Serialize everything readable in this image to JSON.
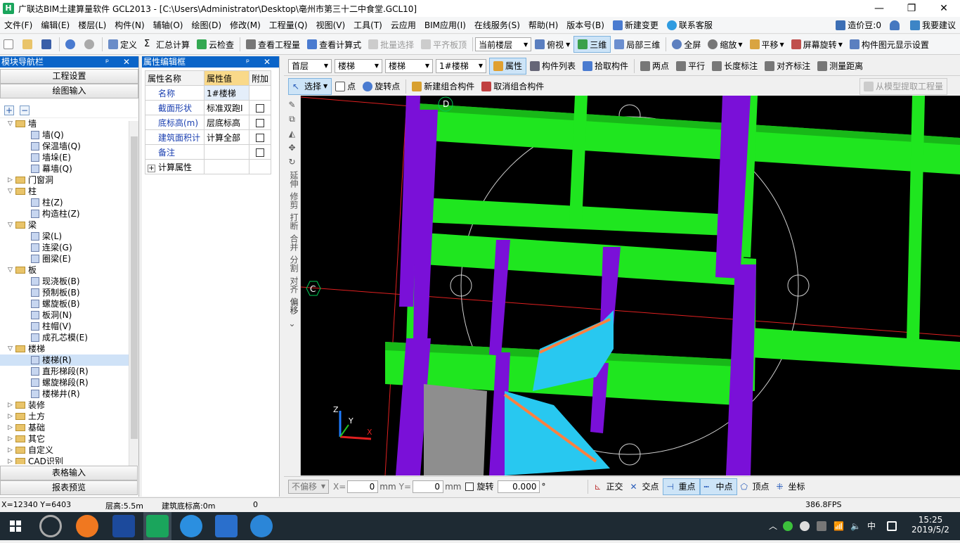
{
  "window": {
    "app_icon": "H",
    "title": "广联达BIM土建算量软件 GCL2013 - [C:\\Users\\Administrator\\Desktop\\亳州市第三十二中食堂.GCL10]",
    "minimize": "—",
    "maximize": "❐",
    "close": "✕"
  },
  "menu": {
    "items": [
      "文件(F)",
      "编辑(E)",
      "楼层(L)",
      "构件(N)",
      "辅轴(O)",
      "绘图(D)",
      "修改(M)",
      "工程量(Q)",
      "视图(V)",
      "工具(T)",
      "云应用",
      "BIM应用(I)",
      "在线服务(S)",
      "帮助(H)",
      "版本号(B)",
      "新建变更",
      "联系客服"
    ],
    "right": {
      "coin": "造价豆:0",
      "feedback": "我要建议"
    }
  },
  "toolbar": {
    "define": "定义",
    "summary": "汇总计算",
    "cloud_check": "云检查",
    "view_qty": "查看工程量",
    "view_formula": "查看计算式",
    "batch_select": "批量选择",
    "flat_top": "平齐板顶",
    "floor_combo": "当前楼层",
    "view_mode": "俯视",
    "three_d": "三维",
    "local_3d": "局部三维",
    "fullscreen": "全屏",
    "zoom": "缩放",
    "pan": "平移",
    "rotate": "屏幕旋转",
    "display_settings": "构件图元显示设置"
  },
  "nav": {
    "title": "模块导航栏",
    "pin": "ᵖ ✕",
    "project_settings": "工程设置",
    "drawing_input": "绘图输入",
    "table_input": "表格输入",
    "report_preview": "报表预览",
    "tree": [
      {
        "label": "墙",
        "level": 0,
        "exp": "▽"
      },
      {
        "label": "墙(Q)",
        "level": 1
      },
      {
        "label": "保温墙(Q)",
        "level": 1
      },
      {
        "label": "墙垛(E)",
        "level": 1
      },
      {
        "label": "幕墙(Q)",
        "level": 1
      },
      {
        "label": "门窗洞",
        "level": 0,
        "exp": "▷"
      },
      {
        "label": "柱",
        "level": 0,
        "exp": "▽"
      },
      {
        "label": "柱(Z)",
        "level": 1
      },
      {
        "label": "构造柱(Z)",
        "level": 1
      },
      {
        "label": "梁",
        "level": 0,
        "exp": "▽"
      },
      {
        "label": "梁(L)",
        "level": 1
      },
      {
        "label": "连梁(G)",
        "level": 1
      },
      {
        "label": "圈梁(E)",
        "level": 1
      },
      {
        "label": "板",
        "level": 0,
        "exp": "▽"
      },
      {
        "label": "现浇板(B)",
        "level": 1
      },
      {
        "label": "预制板(B)",
        "level": 1
      },
      {
        "label": "螺旋板(B)",
        "level": 1
      },
      {
        "label": "板洞(N)",
        "level": 1
      },
      {
        "label": "柱帽(V)",
        "level": 1
      },
      {
        "label": "成孔芯模(E)",
        "level": 1
      },
      {
        "label": "楼梯",
        "level": 0,
        "exp": "▽"
      },
      {
        "label": "楼梯(R)",
        "level": 1,
        "selected": true
      },
      {
        "label": "直形梯段(R)",
        "level": 1
      },
      {
        "label": "螺旋梯段(R)",
        "level": 1
      },
      {
        "label": "楼梯井(R)",
        "level": 1
      },
      {
        "label": "装修",
        "level": 0,
        "exp": "▷"
      },
      {
        "label": "土方",
        "level": 0,
        "exp": "▷"
      },
      {
        "label": "基础",
        "level": 0,
        "exp": "▷"
      },
      {
        "label": "其它",
        "level": 0,
        "exp": "▷"
      },
      {
        "label": "自定义",
        "level": 0,
        "exp": "▷"
      },
      {
        "label": "CAD识别",
        "level": 0,
        "exp": "▷"
      }
    ]
  },
  "props": {
    "title": "属性编辑框",
    "pin": "ᵖ ✕",
    "col_name": "属性名称",
    "col_value": "属性值",
    "col_extra": "附加",
    "rows": [
      {
        "name": "名称",
        "value": "1#楼梯",
        "check": false
      },
      {
        "name": "截面形状",
        "value": "标准双跑I",
        "check": true
      },
      {
        "name": "底标高(m)",
        "value": "层底标高",
        "check": true
      },
      {
        "name": "建筑面积计",
        "value": "计算全部",
        "check": true
      },
      {
        "name": "备注",
        "value": "",
        "check": true
      },
      {
        "name": "计算属性",
        "value": "",
        "check": false,
        "expand": "+"
      }
    ]
  },
  "subbar1": {
    "floor": "首层",
    "cat": "楼梯",
    "type": "楼梯",
    "item": "1#楼梯",
    "attr": "属性",
    "list": "构件列表",
    "pick": "拾取构件",
    "two_point": "两点",
    "parallel": "平行",
    "length_dim": "长度标注",
    "align_dim": "对齐标注",
    "measure": "测量距离"
  },
  "subbar2": {
    "select": "选择",
    "point": "点",
    "rotate_point": "旋转点",
    "new_group": "新建组合构件",
    "cancel_group": "取消组合构件",
    "extract": "从模型提取工程量"
  },
  "vtools": [
    "延伸",
    "修剪",
    "打断",
    "合并",
    "分割",
    "对齐",
    "偏移"
  ],
  "canvas": {
    "axis_d": "D",
    "axis_c": "C",
    "axis_z": "Z",
    "axis_y": "Y",
    "axis_x": "X"
  },
  "bottom": {
    "offset_mode": "不偏移",
    "x_label": "X=",
    "x_val": "0",
    "y_label": "Y=",
    "y_val": "0",
    "unit": "mm",
    "rotate_label": "旋转",
    "rotate_val": "0.000",
    "deg": "°",
    "ortho": "正交",
    "intersect": "交点",
    "endpoint": "重点",
    "midpoint": "中点",
    "vertex": "顶点",
    "coord": "坐标"
  },
  "status": {
    "coords": "X=12340 Y=6403",
    "floor_h": "层高:5.5m",
    "base_elev": "建筑底标高:0m",
    "zero": "0",
    "fps": "386.8FPS"
  },
  "taskbar": {
    "time": "15:25",
    "date": "2019/5/2",
    "ime": "中"
  }
}
